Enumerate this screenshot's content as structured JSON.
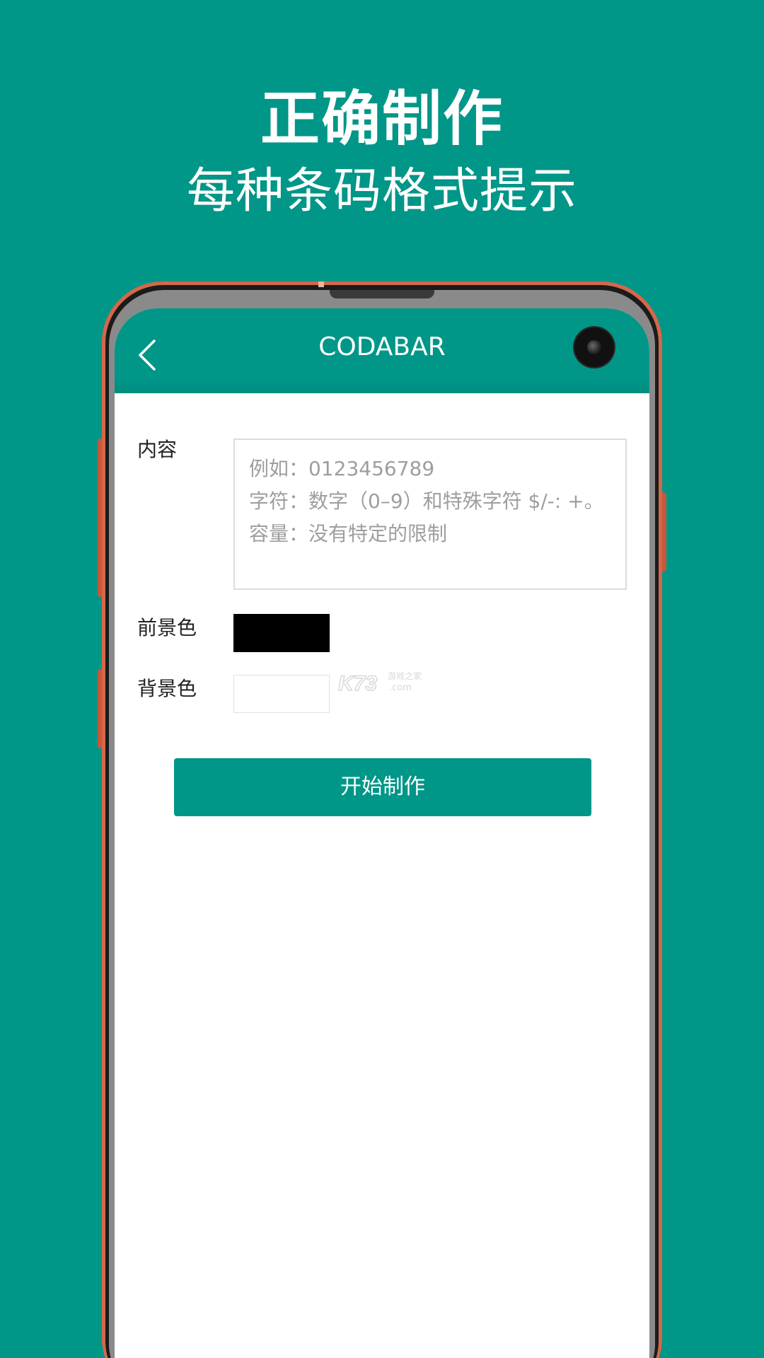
{
  "promo": {
    "headline": "正确制作",
    "subheadline": "每种条码格式提示"
  },
  "app_bar": {
    "title": "CODABAR",
    "back_icon": "chevron-left-icon"
  },
  "form": {
    "content_label": "内容",
    "content_hint_lines": [
      "例如：0123456789",
      "字符：数字（0–9）和特殊字符 $/-: +。",
      "容量：没有特定的限制"
    ],
    "foreground_label": "前景色",
    "foreground_color": "#000000",
    "background_label": "背景色",
    "background_color": "#ffffff",
    "start_button": "开始制作"
  },
  "watermark": {
    "logo": "K73",
    "cn": "游戏之家",
    "domain": ".com"
  },
  "colors": {
    "brand": "#009688",
    "phone_rim": "#d4684a",
    "hint_text": "#9e9e9e"
  }
}
